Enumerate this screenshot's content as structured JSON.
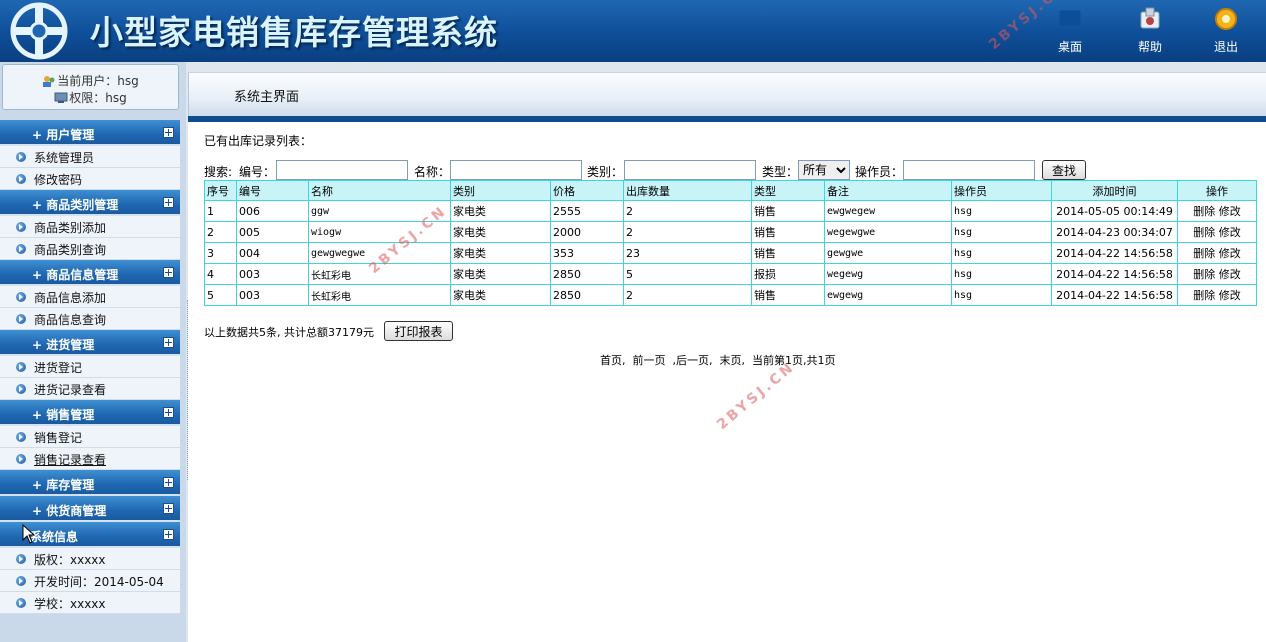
{
  "header": {
    "title": "小型家电销售库存管理系统",
    "buttons": [
      {
        "label": "桌面",
        "icon": "desktop-icon"
      },
      {
        "label": "帮助",
        "icon": "help-icon"
      },
      {
        "label": "退出",
        "icon": "logout-icon"
      }
    ]
  },
  "user": {
    "current": "当前用户：hsg",
    "role": "权限：hsg"
  },
  "menu": [
    {
      "title": "用户管理",
      "items": [
        "系统管理员",
        "修改密码"
      ]
    },
    {
      "title": "商品类别管理",
      "items": [
        "商品类别添加",
        "商品类别查询"
      ]
    },
    {
      "title": "商品信息管理",
      "items": [
        "商品信息添加",
        "商品信息查询"
      ]
    },
    {
      "title": "进货管理",
      "items": [
        "进货登记",
        "进货记录查看"
      ]
    },
    {
      "title": "销售管理",
      "items": [
        "销售登记",
        "销售记录查看"
      ]
    },
    {
      "title": "库存管理",
      "items": []
    },
    {
      "title": "供货商管理",
      "items": []
    },
    {
      "title": "系统信息",
      "items": [
        "版权：xxxxx",
        "开发时间：2014-05-04",
        "学校：xxxxx"
      ]
    }
  ],
  "breadcrumb": "系统主界面",
  "list_title": "已有出库记录列表：",
  "search": {
    "prefix": "搜索:",
    "code_label": "编号：",
    "name_label": "名称：",
    "category_label": "类别：",
    "type_label": "类型：",
    "type_value": "所有",
    "operator_label": "操作员：",
    "button": "查找"
  },
  "table": {
    "columns": [
      "序号",
      "编号",
      "名称",
      "类别",
      "价格",
      "出库数量",
      "类型",
      "备注",
      "操作员",
      "添加时间",
      "操作"
    ],
    "rows": [
      [
        "1",
        "006",
        "ggw",
        "家电类",
        "2555",
        "2",
        "销售",
        "ewgwegew",
        "hsg",
        "2014-05-05 00:14:49"
      ],
      [
        "2",
        "005",
        "wiogw",
        "家电类",
        "2000",
        "2",
        "销售",
        "wegewgwe",
        "hsg",
        "2014-04-23 00:34:07"
      ],
      [
        "3",
        "004",
        "gewgwegwe",
        "家电类",
        "353",
        "23",
        "销售",
        "gewgwe",
        "hsg",
        "2014-04-22 14:56:58"
      ],
      [
        "4",
        "003",
        "长虹彩电",
        "家电类",
        "2850",
        "5",
        "报损",
        "wegewg",
        "hsg",
        "2014-04-22 14:56:58"
      ],
      [
        "5",
        "003",
        "长虹彩电",
        "家电类",
        "2850",
        "2",
        "销售",
        "ewgewg",
        "hsg",
        "2014-04-22 14:56:58"
      ]
    ],
    "delete_label": "删除",
    "edit_label": "修改"
  },
  "summary": "以上数据共5条, 共计总额37179元",
  "print_button": "打印报表",
  "pager": {
    "first": "首页,",
    "prev": "前一页",
    "next": ",后一页,",
    "last": "末页,",
    "info": "当前第1页,共1页"
  },
  "watermark": "2BYSJ.CN",
  "colors": {
    "header_blue": "#0e4e98",
    "table_border": "#3fd5e0",
    "table_header_bg": "#c8f4f7"
  }
}
